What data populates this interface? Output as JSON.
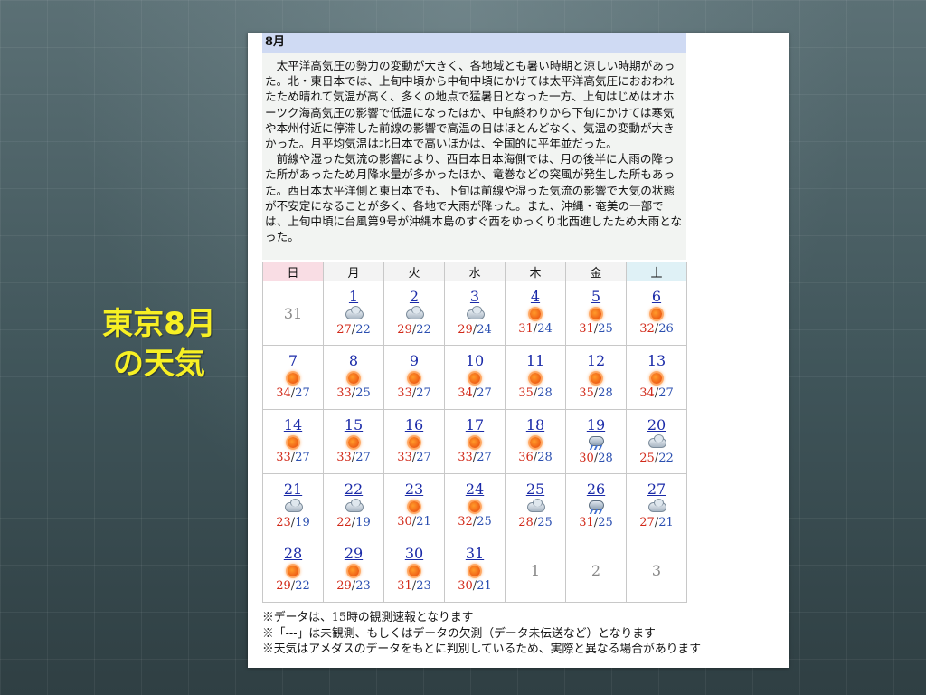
{
  "slide": {
    "title_line1": "東京8月",
    "title_line2": "の天気"
  },
  "month_header": "8月",
  "summary": {
    "para1": "太平洋高気圧の勢力の変動が大きく、各地域とも暑い時期と涼しい時期があった。北・東日本では、上旬中頃から中旬中頃にかけては太平洋高気圧におおわれたため晴れて気温が高く、多くの地点で猛暑日となった一方、上旬はじめはオホーツク海高気圧の影響で低温になったほか、中旬終わりから下旬にかけては寒気や本州付近に停滞した前線の影響で高温の日はほとんどなく、気温の変動が大きかった。月平均気温は北日本で高いほかは、全国的に平年並だった。",
    "para2": "前線や湿った気流の影響により、西日本日本海側では、月の後半に大雨の降った所があったため月降水量が多かったほか、竜巻などの突風が発生した所もあった。西日本太平洋側と東日本でも、下旬は前線や湿った気流の影響で大気の状態が不安定になることが多く、各地で大雨が降った。また、沖縄・奄美の一部では、上旬中頃に台風第9号が沖縄本島のすぐ西をゆっくり北西進したため大雨となった。"
  },
  "weekdays": [
    "日",
    "月",
    "火",
    "水",
    "木",
    "金",
    "土"
  ],
  "calendar": {
    "leading_days": [
      "31"
    ],
    "days": [
      {
        "day": "1",
        "weather": "cloud",
        "hi": "27",
        "lo": "22"
      },
      {
        "day": "2",
        "weather": "cloud",
        "hi": "29",
        "lo": "22"
      },
      {
        "day": "3",
        "weather": "cloud",
        "hi": "29",
        "lo": "24"
      },
      {
        "day": "4",
        "weather": "sun",
        "hi": "31",
        "lo": "24"
      },
      {
        "day": "5",
        "weather": "sun",
        "hi": "31",
        "lo": "25"
      },
      {
        "day": "6",
        "weather": "sun",
        "hi": "32",
        "lo": "26"
      },
      {
        "day": "7",
        "weather": "sun",
        "hi": "34",
        "lo": "27"
      },
      {
        "day": "8",
        "weather": "sun",
        "hi": "33",
        "lo": "25"
      },
      {
        "day": "9",
        "weather": "sun",
        "hi": "33",
        "lo": "27"
      },
      {
        "day": "10",
        "weather": "sun",
        "hi": "34",
        "lo": "27"
      },
      {
        "day": "11",
        "weather": "sun",
        "hi": "35",
        "lo": "28"
      },
      {
        "day": "12",
        "weather": "sun",
        "hi": "35",
        "lo": "28"
      },
      {
        "day": "13",
        "weather": "sun",
        "hi": "34",
        "lo": "27"
      },
      {
        "day": "14",
        "weather": "sun",
        "hi": "33",
        "lo": "27"
      },
      {
        "day": "15",
        "weather": "sun",
        "hi": "33",
        "lo": "27"
      },
      {
        "day": "16",
        "weather": "sun",
        "hi": "33",
        "lo": "27"
      },
      {
        "day": "17",
        "weather": "sun",
        "hi": "33",
        "lo": "27"
      },
      {
        "day": "18",
        "weather": "sun",
        "hi": "36",
        "lo": "28"
      },
      {
        "day": "19",
        "weather": "rain",
        "hi": "30",
        "lo": "28"
      },
      {
        "day": "20",
        "weather": "cloud",
        "hi": "25",
        "lo": "22"
      },
      {
        "day": "21",
        "weather": "cloud",
        "hi": "23",
        "lo": "19"
      },
      {
        "day": "22",
        "weather": "cloud",
        "hi": "22",
        "lo": "19"
      },
      {
        "day": "23",
        "weather": "sun",
        "hi": "30",
        "lo": "21"
      },
      {
        "day": "24",
        "weather": "sun",
        "hi": "32",
        "lo": "25"
      },
      {
        "day": "25",
        "weather": "cloud",
        "hi": "28",
        "lo": "25"
      },
      {
        "day": "26",
        "weather": "rain",
        "hi": "31",
        "lo": "25"
      },
      {
        "day": "27",
        "weather": "cloud",
        "hi": "27",
        "lo": "21"
      },
      {
        "day": "28",
        "weather": "sun",
        "hi": "29",
        "lo": "22"
      },
      {
        "day": "29",
        "weather": "sun",
        "hi": "29",
        "lo": "23"
      },
      {
        "day": "30",
        "weather": "sun",
        "hi": "31",
        "lo": "23"
      },
      {
        "day": "31",
        "weather": "sun",
        "hi": "30",
        "lo": "21"
      }
    ],
    "trailing_days": [
      "1",
      "2",
      "3"
    ]
  },
  "notes": [
    "※データは、15時の観測速報となります",
    "※「---」は未観測、もしくはデータの欠測（データ未伝送など）となります",
    "※天気はアメダスのデータをもとに判別しているため、実際と異なる場合があります"
  ],
  "colors": {
    "title_yellow": "#f7f024",
    "header_blue": "#cfdaf3",
    "high_temp": "#d12a1a",
    "low_temp": "#2b4fb0",
    "link": "#1a2aa8"
  }
}
